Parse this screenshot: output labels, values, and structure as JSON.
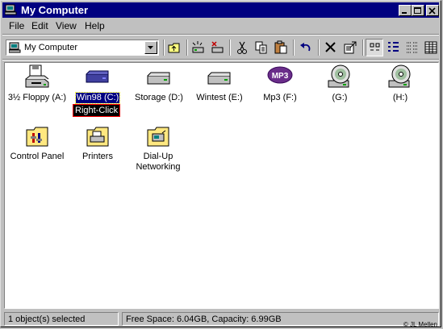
{
  "window": {
    "title": "My Computer"
  },
  "menu": [
    "File",
    "Edit",
    "View",
    "Help"
  ],
  "address": {
    "value": "My Computer"
  },
  "toolbar": {
    "buttons": [
      "up-folder",
      "map-drive",
      "disconnect-drive",
      "cut",
      "copy",
      "paste",
      "undo",
      "delete",
      "properties",
      "large-icons",
      "small-icons",
      "list",
      "details"
    ]
  },
  "items": [
    {
      "label": "3½ Floppy (A:)",
      "icon": "floppy-drive-icon"
    },
    {
      "label": "Win98 (C:)",
      "icon": "hard-drive-icon",
      "selected": true
    },
    {
      "label": "Storage (D:)",
      "icon": "hard-drive-icon"
    },
    {
      "label": "Wintest (E:)",
      "icon": "hard-drive-icon"
    },
    {
      "label": "Mp3 (F:)",
      "icon": "mp3-drive-icon"
    },
    {
      "label": "(G:)",
      "icon": "cd-drive-icon"
    },
    {
      "label": "(H:)",
      "icon": "cd-drive-icon"
    },
    {
      "label": "Control Panel",
      "icon": "control-panel-icon"
    },
    {
      "label": "Printers",
      "icon": "printers-icon"
    },
    {
      "label": "Dial-Up\nNetworking",
      "icon": "dialup-networking-icon"
    }
  ],
  "tooltip": "Right-Click",
  "status": {
    "left": "1 object(s) selected",
    "right": "Free Space: 6.04GB,  Capacity: 6.99GB"
  },
  "copyright": "© JL Mellen"
}
